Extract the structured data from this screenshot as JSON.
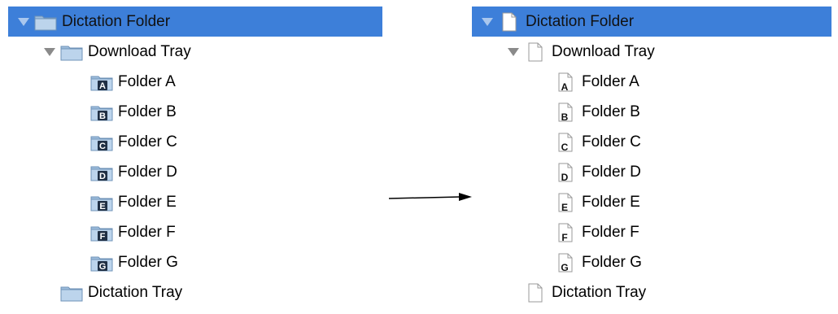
{
  "before": {
    "root": {
      "label": "Dictation Folder"
    },
    "download_tray": {
      "label": "Download Tray"
    },
    "folders": [
      {
        "label": "Folder A",
        "letter": "A"
      },
      {
        "label": "Folder B",
        "letter": "B"
      },
      {
        "label": "Folder C",
        "letter": "C"
      },
      {
        "label": "Folder D",
        "letter": "D"
      },
      {
        "label": "Folder E",
        "letter": "E"
      },
      {
        "label": "Folder F",
        "letter": "F"
      },
      {
        "label": "Folder G",
        "letter": "G"
      }
    ],
    "dictation_tray": {
      "label": "Dictation Tray"
    }
  },
  "after": {
    "root": {
      "label": "Dictation Folder"
    },
    "download_tray": {
      "label": "Download Tray"
    },
    "folders": [
      {
        "label": "Folder A",
        "letter": "A"
      },
      {
        "label": "Folder B",
        "letter": "B"
      },
      {
        "label": "Folder C",
        "letter": "C"
      },
      {
        "label": "Folder D",
        "letter": "D"
      },
      {
        "label": "Folder E",
        "letter": "E"
      },
      {
        "label": "Folder F",
        "letter": "F"
      },
      {
        "label": "Folder G",
        "letter": "G"
      }
    ],
    "dictation_tray": {
      "label": "Dictation Tray"
    }
  },
  "colors": {
    "selection": "#3d7fd9",
    "folder_icon": "#a9c6e3",
    "document_icon": "#ffffff"
  }
}
